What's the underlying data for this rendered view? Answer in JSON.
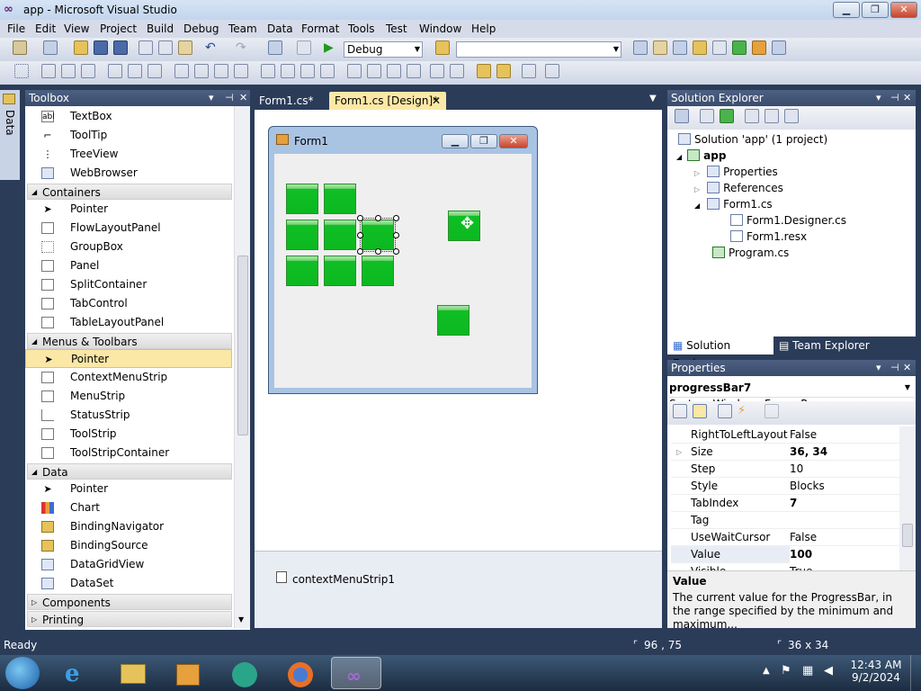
{
  "window": {
    "title": "app - Microsoft Visual Studio",
    "minimize": "▁",
    "maximize": "❐",
    "close": "✕"
  },
  "menu": [
    "File",
    "Edit",
    "View",
    "Project",
    "Build",
    "Debug",
    "Team",
    "Data",
    "Format",
    "Tools",
    "Test",
    "Window",
    "Help"
  ],
  "toolbar": {
    "config": "Debug",
    "platform": ""
  },
  "side_tab": "Data Sources",
  "toolbox": {
    "title": "Toolbox",
    "items_top": [
      "TextBox",
      "ToolTip",
      "TreeView",
      "WebBrowser"
    ],
    "containers_label": "Containers",
    "containers": [
      "Pointer",
      "FlowLayoutPanel",
      "GroupBox",
      "Panel",
      "SplitContainer",
      "TabControl",
      "TableLayoutPanel"
    ],
    "menus_label": "Menus & Toolbars",
    "menus": [
      "Pointer",
      "ContextMenuStrip",
      "MenuStrip",
      "StatusStrip",
      "ToolStrip",
      "ToolStripContainer"
    ],
    "data_label": "Data",
    "data": [
      "Pointer",
      "Chart",
      "BindingNavigator",
      "BindingSource",
      "DataGridView",
      "DataSet"
    ],
    "components_label": "Components",
    "printing_label": "Printing"
  },
  "doc_tabs": {
    "tab1": "Form1.cs*",
    "tab2": "Form1.cs [Design]*"
  },
  "designer": {
    "form_title": "Form1",
    "tray_item": "contextMenuStrip1",
    "progress_value": 100
  },
  "solution": {
    "title": "Solution Explorer",
    "root": "Solution 'app' (1 project)",
    "project": "app",
    "nodes": [
      "Properties",
      "References",
      "Form1.cs",
      "Form1.Designer.cs",
      "Form1.resx",
      "Program.cs"
    ],
    "tab_solution": "Solution Explorer",
    "tab_team": "Team Explorer"
  },
  "properties": {
    "title": "Properties",
    "object": "progressBar7",
    "type": "System.Windows.Forms.Progress",
    "rows": [
      {
        "name": "RightToLeftLayout",
        "value": "False"
      },
      {
        "name": "Size",
        "value": "36, 34"
      },
      {
        "name": "Step",
        "value": "10"
      },
      {
        "name": "Style",
        "value": "Blocks"
      },
      {
        "name": "TabIndex",
        "value": "7"
      },
      {
        "name": "Tag",
        "value": ""
      },
      {
        "name": "UseWaitCursor",
        "value": "False"
      },
      {
        "name": "Value",
        "value": "100"
      },
      {
        "name": "Visible",
        "value": "True"
      }
    ],
    "desc_title": "Value",
    "desc_text": "The current value for the ProgressBar, in the range specified by the minimum and maximum..."
  },
  "status": {
    "ready": "Ready",
    "position": "96 , 75",
    "size": "36 x 34"
  },
  "clock": {
    "time": "12:43 AM",
    "date": "9/2/2024"
  }
}
